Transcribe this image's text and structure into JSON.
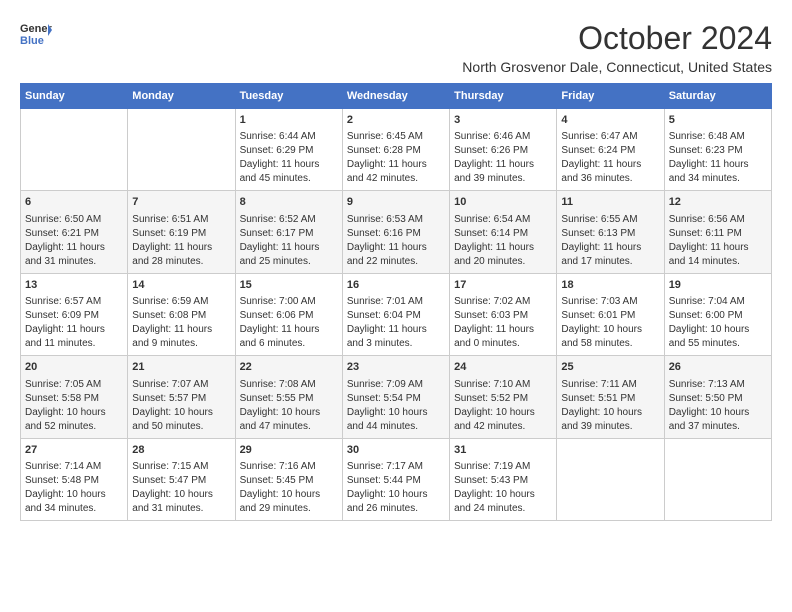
{
  "logo": {
    "line1": "General",
    "line2": "Blue"
  },
  "title": "October 2024",
  "location": "North Grosvenor Dale, Connecticut, United States",
  "days_of_week": [
    "Sunday",
    "Monday",
    "Tuesday",
    "Wednesday",
    "Thursday",
    "Friday",
    "Saturday"
  ],
  "weeks": [
    [
      {
        "day": "",
        "info": ""
      },
      {
        "day": "",
        "info": ""
      },
      {
        "day": "1",
        "info": "Sunrise: 6:44 AM\nSunset: 6:29 PM\nDaylight: 11 hours and 45 minutes."
      },
      {
        "day": "2",
        "info": "Sunrise: 6:45 AM\nSunset: 6:28 PM\nDaylight: 11 hours and 42 minutes."
      },
      {
        "day": "3",
        "info": "Sunrise: 6:46 AM\nSunset: 6:26 PM\nDaylight: 11 hours and 39 minutes."
      },
      {
        "day": "4",
        "info": "Sunrise: 6:47 AM\nSunset: 6:24 PM\nDaylight: 11 hours and 36 minutes."
      },
      {
        "day": "5",
        "info": "Sunrise: 6:48 AM\nSunset: 6:23 PM\nDaylight: 11 hours and 34 minutes."
      }
    ],
    [
      {
        "day": "6",
        "info": "Sunrise: 6:50 AM\nSunset: 6:21 PM\nDaylight: 11 hours and 31 minutes."
      },
      {
        "day": "7",
        "info": "Sunrise: 6:51 AM\nSunset: 6:19 PM\nDaylight: 11 hours and 28 minutes."
      },
      {
        "day": "8",
        "info": "Sunrise: 6:52 AM\nSunset: 6:17 PM\nDaylight: 11 hours and 25 minutes."
      },
      {
        "day": "9",
        "info": "Sunrise: 6:53 AM\nSunset: 6:16 PM\nDaylight: 11 hours and 22 minutes."
      },
      {
        "day": "10",
        "info": "Sunrise: 6:54 AM\nSunset: 6:14 PM\nDaylight: 11 hours and 20 minutes."
      },
      {
        "day": "11",
        "info": "Sunrise: 6:55 AM\nSunset: 6:13 PM\nDaylight: 11 hours and 17 minutes."
      },
      {
        "day": "12",
        "info": "Sunrise: 6:56 AM\nSunset: 6:11 PM\nDaylight: 11 hours and 14 minutes."
      }
    ],
    [
      {
        "day": "13",
        "info": "Sunrise: 6:57 AM\nSunset: 6:09 PM\nDaylight: 11 hours and 11 minutes."
      },
      {
        "day": "14",
        "info": "Sunrise: 6:59 AM\nSunset: 6:08 PM\nDaylight: 11 hours and 9 minutes."
      },
      {
        "day": "15",
        "info": "Sunrise: 7:00 AM\nSunset: 6:06 PM\nDaylight: 11 hours and 6 minutes."
      },
      {
        "day": "16",
        "info": "Sunrise: 7:01 AM\nSunset: 6:04 PM\nDaylight: 11 hours and 3 minutes."
      },
      {
        "day": "17",
        "info": "Sunrise: 7:02 AM\nSunset: 6:03 PM\nDaylight: 11 hours and 0 minutes."
      },
      {
        "day": "18",
        "info": "Sunrise: 7:03 AM\nSunset: 6:01 PM\nDaylight: 10 hours and 58 minutes."
      },
      {
        "day": "19",
        "info": "Sunrise: 7:04 AM\nSunset: 6:00 PM\nDaylight: 10 hours and 55 minutes."
      }
    ],
    [
      {
        "day": "20",
        "info": "Sunrise: 7:05 AM\nSunset: 5:58 PM\nDaylight: 10 hours and 52 minutes."
      },
      {
        "day": "21",
        "info": "Sunrise: 7:07 AM\nSunset: 5:57 PM\nDaylight: 10 hours and 50 minutes."
      },
      {
        "day": "22",
        "info": "Sunrise: 7:08 AM\nSunset: 5:55 PM\nDaylight: 10 hours and 47 minutes."
      },
      {
        "day": "23",
        "info": "Sunrise: 7:09 AM\nSunset: 5:54 PM\nDaylight: 10 hours and 44 minutes."
      },
      {
        "day": "24",
        "info": "Sunrise: 7:10 AM\nSunset: 5:52 PM\nDaylight: 10 hours and 42 minutes."
      },
      {
        "day": "25",
        "info": "Sunrise: 7:11 AM\nSunset: 5:51 PM\nDaylight: 10 hours and 39 minutes."
      },
      {
        "day": "26",
        "info": "Sunrise: 7:13 AM\nSunset: 5:50 PM\nDaylight: 10 hours and 37 minutes."
      }
    ],
    [
      {
        "day": "27",
        "info": "Sunrise: 7:14 AM\nSunset: 5:48 PM\nDaylight: 10 hours and 34 minutes."
      },
      {
        "day": "28",
        "info": "Sunrise: 7:15 AM\nSunset: 5:47 PM\nDaylight: 10 hours and 31 minutes."
      },
      {
        "day": "29",
        "info": "Sunrise: 7:16 AM\nSunset: 5:45 PM\nDaylight: 10 hours and 29 minutes."
      },
      {
        "day": "30",
        "info": "Sunrise: 7:17 AM\nSunset: 5:44 PM\nDaylight: 10 hours and 26 minutes."
      },
      {
        "day": "31",
        "info": "Sunrise: 7:19 AM\nSunset: 5:43 PM\nDaylight: 10 hours and 24 minutes."
      },
      {
        "day": "",
        "info": ""
      },
      {
        "day": "",
        "info": ""
      }
    ]
  ]
}
